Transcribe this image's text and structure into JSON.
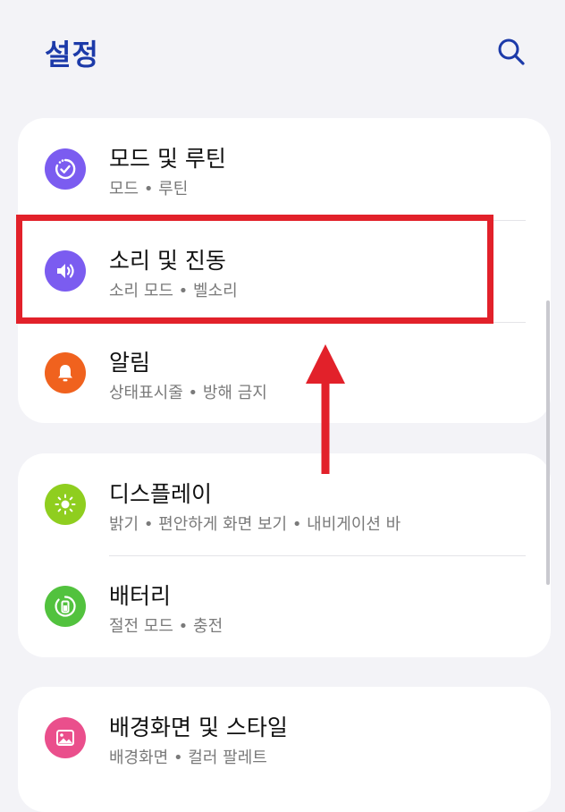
{
  "header": {
    "title": "설정",
    "search_icon": "search-icon"
  },
  "cards": [
    {
      "items": [
        {
          "id": "modes-routines",
          "title": "모드 및 루틴",
          "subtitle": "모드 • 루틴",
          "icon": "routine-icon",
          "color": "#7b5cf0"
        },
        {
          "id": "sound-vibration",
          "title": "소리 및 진동",
          "subtitle": "소리 모드 • 벨소리",
          "icon": "speaker-icon",
          "color": "#7b5cf0"
        },
        {
          "id": "notifications",
          "title": "알림",
          "subtitle": "상태표시줄 • 방해 금지",
          "icon": "bell-icon",
          "color": "#f0621e"
        }
      ]
    },
    {
      "items": [
        {
          "id": "display",
          "title": "디스플레이",
          "subtitle": "밝기 • 편안하게 화면 보기 • 내비게이션 바",
          "icon": "sun-icon",
          "color": "#8fce1f"
        },
        {
          "id": "battery",
          "title": "배터리",
          "subtitle": "절전 모드 • 충전",
          "icon": "battery-icon",
          "color": "#52c23e"
        }
      ]
    },
    {
      "items": [
        {
          "id": "wallpaper-style",
          "title": "배경화면 및 스타일",
          "subtitle": "배경화면 • 컬러 팔레트",
          "icon": "image-icon",
          "color": "#ea4f8c"
        }
      ]
    }
  ],
  "annotation": {
    "highlight_color": "#e2212a",
    "arrow_color": "#e2212a"
  }
}
